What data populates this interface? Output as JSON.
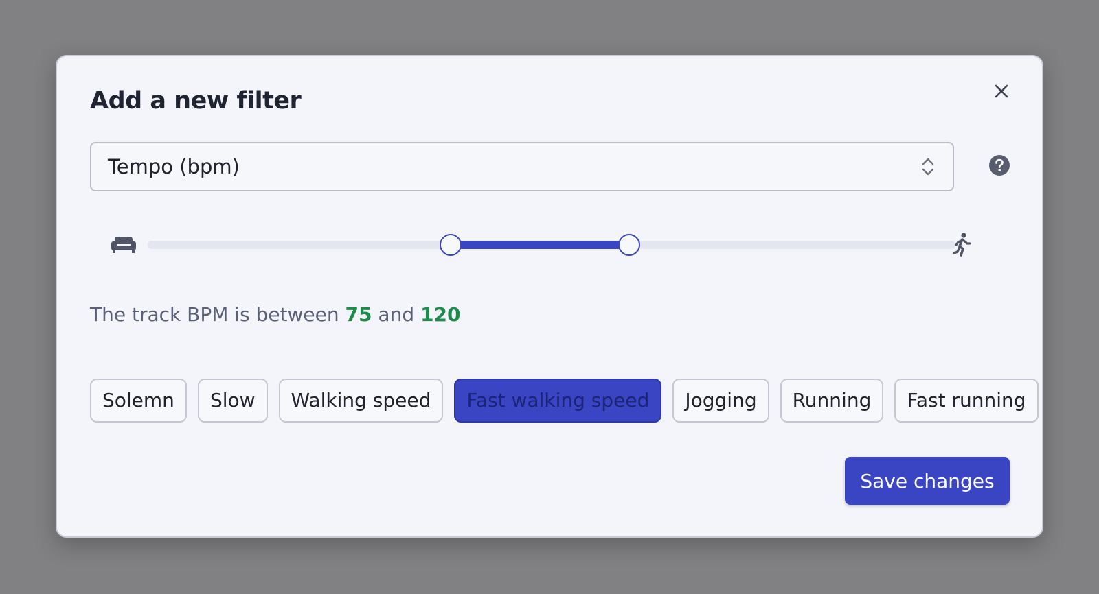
{
  "dialog": {
    "title": "Add a new filter",
    "close_icon": "close-icon"
  },
  "filter_select": {
    "value": "Tempo (bpm)",
    "caret_icon": "chevron-up-down-icon",
    "help_icon": "help-circle-icon"
  },
  "slider": {
    "min_icon": "sofa-icon",
    "max_icon": "running-person-icon",
    "range_start_fraction": 0.375,
    "range_end_fraction": 0.596,
    "low": "75",
    "high": "120"
  },
  "summary": {
    "prefix": "The track BPM is between",
    "low": "75",
    "joiner": "and",
    "high": "120"
  },
  "presets": [
    {
      "label": "Solemn",
      "active": false
    },
    {
      "label": "Slow",
      "active": false
    },
    {
      "label": "Walking speed",
      "active": false
    },
    {
      "label": "Fast walking speed",
      "active": true
    },
    {
      "label": "Jogging",
      "active": false
    },
    {
      "label": "Running",
      "active": false
    },
    {
      "label": "Fast running",
      "active": false
    }
  ],
  "actions": {
    "save_label": "Save changes"
  },
  "colors": {
    "accent": "#3a45c4",
    "value_green": "#1d8b4a",
    "backdrop": "#818184",
    "dialog_bg": "#f4f5fa"
  }
}
